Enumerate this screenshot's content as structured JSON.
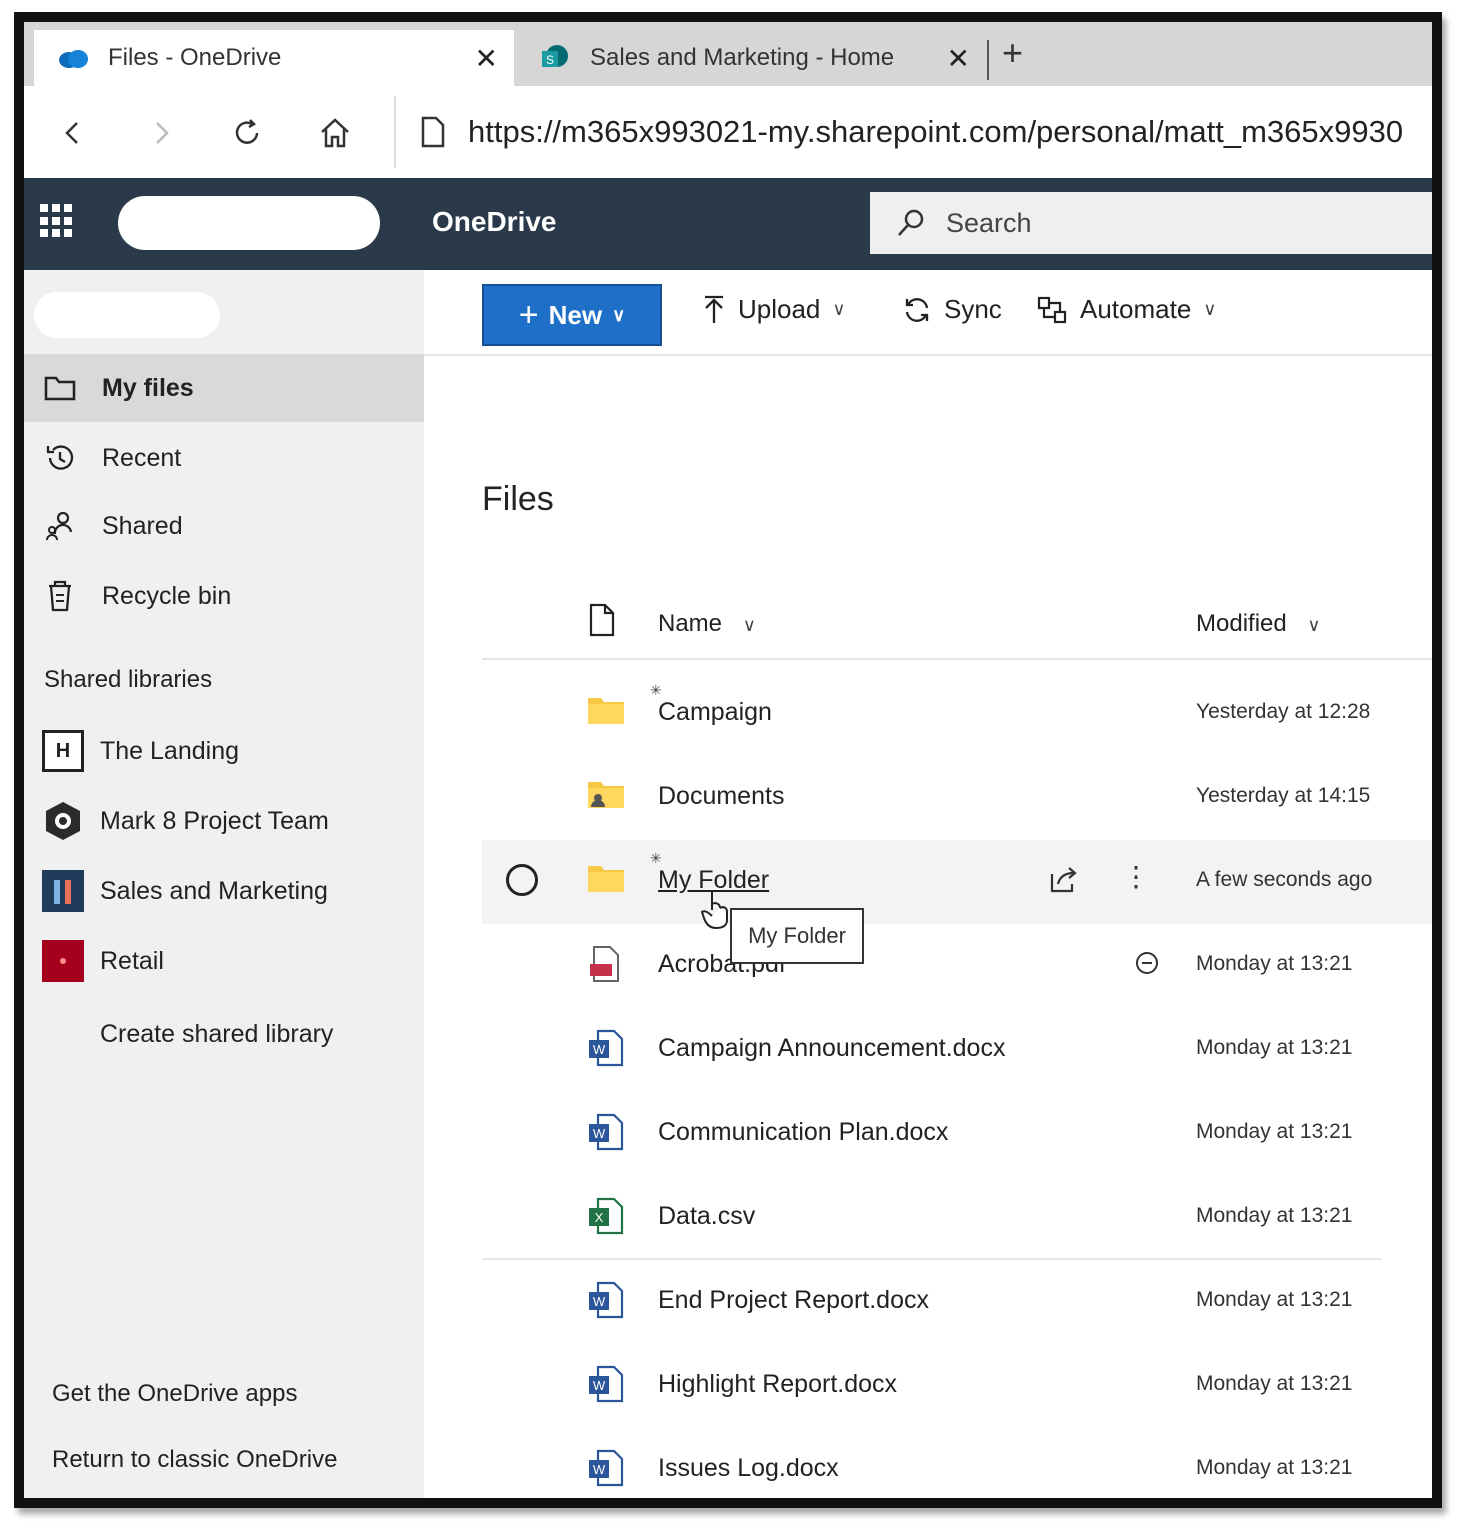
{
  "browser": {
    "tabs": [
      {
        "title": "Files - OneDrive",
        "close": "✕"
      },
      {
        "title": "Sales and Marketing - Home",
        "close": "✕"
      }
    ],
    "new_tab": "+",
    "url": "https://m365x993021-my.sharepoint.com/personal/matt_m365x9930"
  },
  "suite": {
    "app_name": "OneDrive",
    "search_placeholder": "Search"
  },
  "nav": {
    "items": [
      {
        "label": "My files",
        "icon": "folder-icon",
        "selected": true
      },
      {
        "label": "Recent",
        "icon": "history-icon"
      },
      {
        "label": "Shared",
        "icon": "people-icon"
      },
      {
        "label": "Recycle bin",
        "icon": "recycle-bin-icon"
      }
    ],
    "shared_libraries_heading": "Shared libraries",
    "libraries": [
      {
        "label": "The Landing",
        "badge": "H",
        "color": "#ffffff"
      },
      {
        "label": "Mark 8 Project Team",
        "badge": "",
        "color": "#2b2b2b"
      },
      {
        "label": "Sales and Marketing",
        "badge": "",
        "color": "#1f3c5a"
      },
      {
        "label": "Retail",
        "badge": "",
        "color": "#a4001d"
      }
    ],
    "create_library": "Create shared library",
    "get_apps": "Get the OneDrive apps",
    "return_classic": "Return to classic OneDrive"
  },
  "commands": {
    "new": "New",
    "upload": "Upload",
    "sync": "Sync",
    "automate": "Automate"
  },
  "main": {
    "title": "Files",
    "columns": {
      "name": "Name",
      "modified": "Modified"
    },
    "files": [
      {
        "name": "Campaign",
        "modified": "Yesterday at 12:28",
        "type": "folder"
      },
      {
        "name": "Documents",
        "modified": "Yesterday at 14:15",
        "type": "shared-folder"
      },
      {
        "name": "My Folder",
        "modified": "A few seconds ago",
        "type": "folder"
      },
      {
        "name": "Acrobat.pdf",
        "modified": "Monday at 13:21",
        "type": "pdf"
      },
      {
        "name": "Campaign Announcement.docx",
        "modified": "Monday at 13:21",
        "type": "docx"
      },
      {
        "name": "Communication Plan.docx",
        "modified": "Monday at 13:21",
        "type": "docx"
      },
      {
        "name": "Data.csv",
        "modified": "Monday at 13:21",
        "type": "csv"
      },
      {
        "name": "End Project Report.docx",
        "modified": "Monday at 13:21",
        "type": "docx"
      },
      {
        "name": "Highlight Report.docx",
        "modified": "Monday at 13:21",
        "type": "docx"
      },
      {
        "name": "Issues Log.docx",
        "modified": "Monday at 13:21",
        "type": "docx"
      }
    ],
    "tooltip": "My Folder"
  }
}
